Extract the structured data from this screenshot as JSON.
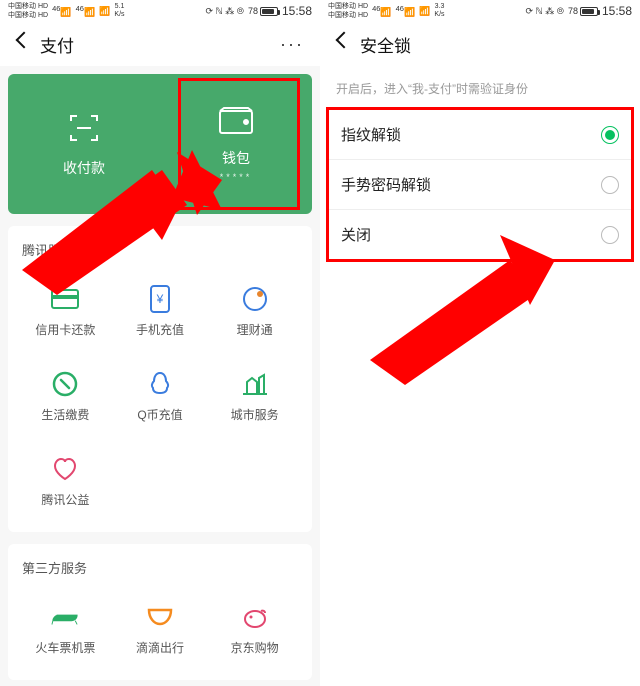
{
  "status": {
    "carrier": "中国移动",
    "net": "HD",
    "sig1": "46",
    "sig2": "46",
    "speed_left": "5.1\nK/s",
    "speed_right": "3.3\nK/s",
    "icons": "⟳ ℕ ⁂ ⦾",
    "battery": "78",
    "time": "15:58"
  },
  "left": {
    "title": "支付",
    "hero": {
      "pay_label": "收付款",
      "wallet_label": "钱包",
      "wallet_sub": "*****"
    },
    "section1_title": "腾讯服务",
    "section1_items": [
      {
        "label": "信用卡还款",
        "icon": "credit"
      },
      {
        "label": "手机充值",
        "icon": "topup"
      },
      {
        "label": "理财通",
        "icon": "wealth"
      },
      {
        "label": "生活缴费",
        "icon": "bill"
      },
      {
        "label": "Q币充值",
        "icon": "qcoin"
      },
      {
        "label": "城市服务",
        "icon": "city"
      },
      {
        "label": "腾讯公益",
        "icon": "charity"
      }
    ],
    "section2_title": "第三方服务",
    "section2_items": [
      {
        "label": "火车票机票",
        "icon": "train"
      },
      {
        "label": "滴滴出行",
        "icon": "didi"
      },
      {
        "label": "京东购物",
        "icon": "jd"
      }
    ]
  },
  "right": {
    "title": "安全锁",
    "hint": "开启后，进入“我-支付”时需验证身份",
    "options": [
      {
        "label": "指纹解锁",
        "selected": true
      },
      {
        "label": "手势密码解锁",
        "selected": false
      },
      {
        "label": "关闭",
        "selected": false
      }
    ]
  },
  "colors": {
    "green": "#47a96b",
    "accent": "#07c160",
    "red": "#ff0000"
  }
}
